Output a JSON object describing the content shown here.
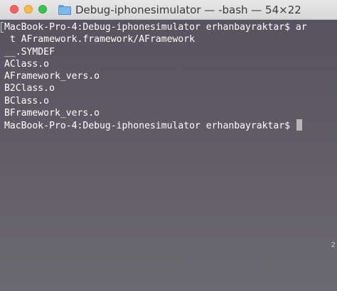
{
  "window": {
    "title": "Debug-iphonesimulator — -bash — 54×22"
  },
  "terminal": {
    "lines": [
      "MacBook-Pro-4:Debug-iphonesimulator erhanbayraktar$ ar",
      " t AFramework.framework/AFramework",
      "__.SYMDEF",
      "AClass.o",
      "AFramework_vers.o",
      "B2Class.o",
      "BClass.o",
      "BFramework_vers.o"
    ],
    "prompt": "MacBook-Pro-4:Debug-iphonesimulator erhanbayraktar$ ",
    "edge_glyph": "2"
  },
  "icons": {
    "title_icon": "folder-icon"
  },
  "colors": {
    "terminal_background": "#5e5a66",
    "text": "#ffffff",
    "cursor": "#b8b6bb",
    "close": "#fc605c",
    "minimize": "#fdbc40",
    "zoom": "#34c84a"
  }
}
